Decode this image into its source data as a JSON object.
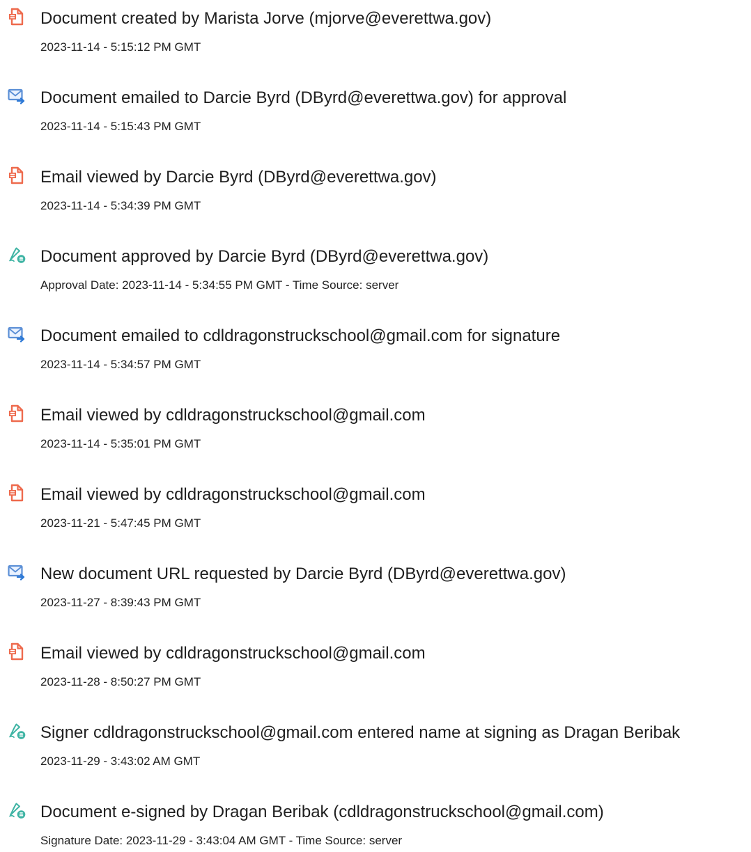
{
  "colors": {
    "document_icon": "#ee6a4d",
    "email_icon": "#5b8fd6",
    "email_arrow": "#2d79d6",
    "signature_icon": "#3fb4a4"
  },
  "events": [
    {
      "icon": "document-icon",
      "title": "Document created by Marista Jorve (mjorve@everettwa.gov)",
      "detail": "2023-11-14 - 5:15:12 PM GMT"
    },
    {
      "icon": "email-icon",
      "title": "Document emailed to Darcie Byrd (DByrd@everettwa.gov) for approval",
      "detail": "2023-11-14 - 5:15:43 PM GMT"
    },
    {
      "icon": "document-icon",
      "title": "Email viewed by Darcie Byrd (DByrd@everettwa.gov)",
      "detail": "2023-11-14 - 5:34:39 PM GMT"
    },
    {
      "icon": "signature-icon",
      "title": "Document approved by Darcie Byrd (DByrd@everettwa.gov)",
      "detail": "Approval Date: 2023-11-14 - 5:34:55 PM GMT - Time Source: server"
    },
    {
      "icon": "email-icon",
      "title": "Document emailed to cdldragonstruckschool@gmail.com for signature",
      "detail": "2023-11-14 - 5:34:57 PM GMT"
    },
    {
      "icon": "document-icon",
      "title": "Email viewed by cdldragonstruckschool@gmail.com",
      "detail": "2023-11-14 - 5:35:01 PM GMT"
    },
    {
      "icon": "document-icon",
      "title": "Email viewed by cdldragonstruckschool@gmail.com",
      "detail": "2023-11-21 - 5:47:45 PM GMT"
    },
    {
      "icon": "email-icon",
      "title": "New document URL requested by Darcie Byrd (DByrd@everettwa.gov)",
      "detail": "2023-11-27 - 8:39:43 PM GMT"
    },
    {
      "icon": "document-icon",
      "title": "Email viewed by cdldragonstruckschool@gmail.com",
      "detail": "2023-11-28 - 8:50:27 PM GMT"
    },
    {
      "icon": "signature-icon",
      "title": "Signer cdldragonstruckschool@gmail.com entered name at signing as Dragan Beribak",
      "detail": "2023-11-29 - 3:43:02 AM GMT"
    },
    {
      "icon": "signature-icon",
      "title": "Document e-signed by Dragan Beribak (cdldragonstruckschool@gmail.com)",
      "detail": "Signature Date: 2023-11-29 - 3:43:04 AM GMT - Time Source: server"
    }
  ]
}
